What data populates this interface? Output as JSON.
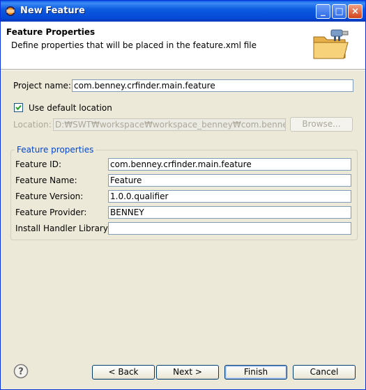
{
  "window": {
    "title": "New Feature",
    "minimize_label": "_",
    "maximize_label": "□",
    "close_label": "×"
  },
  "header": {
    "title": "Feature Properties",
    "description": "Define properties that will be placed in the feature.xml file"
  },
  "project": {
    "name_label": "Project name:",
    "name_value": "com.benney.crfinder.main.feature",
    "use_default_label": "Use default location",
    "use_default_checked": true,
    "location_label": "Location:",
    "location_value": "D:₩SWT₩workspace₩workspace_benney₩com.benney.",
    "browse_label": "Browse..."
  },
  "feature_properties": {
    "group_title": "Feature properties",
    "id_label": "Feature ID:",
    "id_value": "com.benney.crfinder.main.feature",
    "name_label": "Feature Name:",
    "name_value": "Feature",
    "version_label": "Feature Version:",
    "version_value": "1.0.0.qualifier",
    "provider_label": "Feature Provider:",
    "provider_value": "BENNEY",
    "install_handler_label": "Install Handler Library:",
    "install_handler_value": ""
  },
  "buttons": {
    "back": "< Back",
    "next": "Next >",
    "finish": "Finish",
    "cancel": "Cancel"
  },
  "icons": {
    "title_icon": "eclipse-icon",
    "header_icon": "folder-plugin-icon",
    "help_icon": "help-icon"
  }
}
